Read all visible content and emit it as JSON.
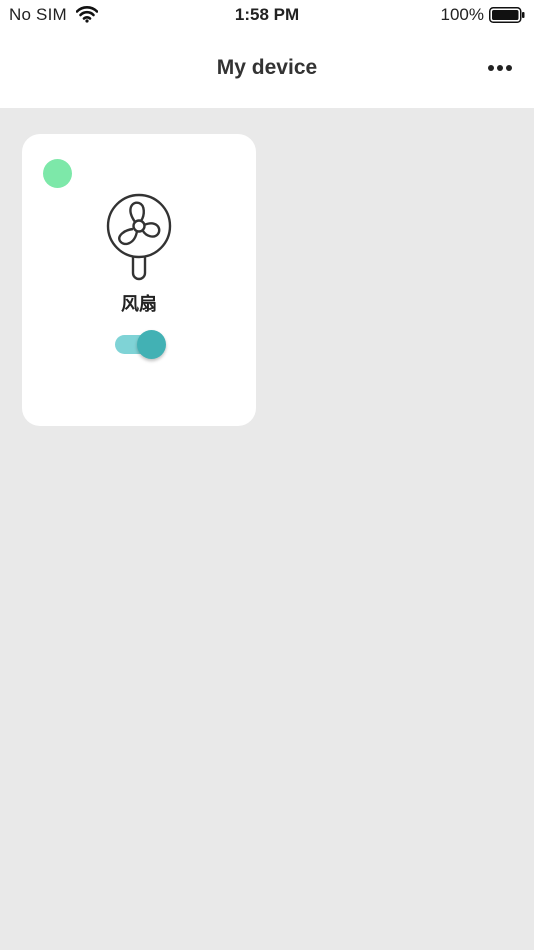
{
  "status_bar": {
    "carrier": "No SIM",
    "time": "1:58 PM",
    "battery_percent": "100%",
    "wifi_icon": "wifi-icon",
    "battery_icon": "battery-full-icon"
  },
  "nav": {
    "title": "My device",
    "more_icon": "more-horizontal-icon"
  },
  "devices": [
    {
      "name": "风扇",
      "icon": "fan-icon",
      "online": true,
      "power_on": true
    }
  ],
  "colors": {
    "background": "#e9e9e9",
    "online_dot": "#7de8a9",
    "toggle_track": "#7fd3d6",
    "toggle_knob": "#42b1b4",
    "icon_stroke": "#333333"
  }
}
